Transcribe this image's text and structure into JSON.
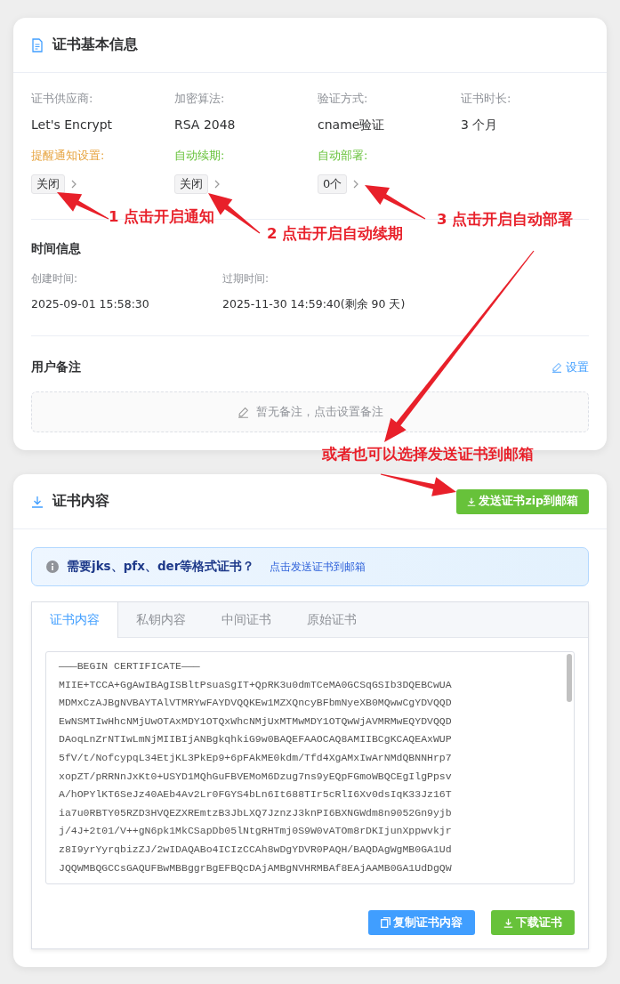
{
  "basic_info": {
    "title": "证书基本信息",
    "fields": [
      {
        "label": "证书供应商:",
        "value": "Let's Encrypt"
      },
      {
        "label": "加密算法:",
        "value": "RSA 2048"
      },
      {
        "label": "验证方式:",
        "value": "cname验证"
      },
      {
        "label": "证书时长:",
        "value": "3 个月"
      }
    ],
    "settings": [
      {
        "label": "提醒通知设置:",
        "value": "关闭",
        "color": "#e6a23c"
      },
      {
        "label": "自动续期:",
        "value": "关闭",
        "color": "#67c23a"
      },
      {
        "label": "自动部署:",
        "value": "0个",
        "color": "#67c23a"
      }
    ],
    "time_info": {
      "title": "时间信息",
      "fields": [
        {
          "label": "创建时间:",
          "value": "2025-09-01 15:58:30"
        },
        {
          "label": "过期时间:",
          "value": "2025-11-30 14:59:40(剩余 90 天)"
        }
      ]
    },
    "remarks": {
      "title": "用户备注",
      "action": "设置",
      "empty_text": "暂无备注，点击设置备注"
    }
  },
  "cert_content": {
    "title": "证书内容",
    "send_button": "发送证书zip到邮箱",
    "notice": {
      "text": "需要jks、pfx、der等格式证书？",
      "link": "点击发送证书到邮箱"
    },
    "tabs": [
      {
        "label": "证书内容",
        "selected": true
      },
      {
        "label": "私钥内容",
        "selected": false
      },
      {
        "label": "中间证书",
        "selected": false
      },
      {
        "label": "原始证书",
        "selected": false
      }
    ],
    "lines": [
      "———BEGIN CERTIFICATE———",
      "MIIE+TCCA+GgAwIBAgISBltPsuaSgIT+QpRK3u0dmTCeMA0GCSqGSIb3DQEBCwUA",
      "MDMxCzAJBgNVBAYTAlVTMRYwFAYDVQQKEw1MZXQncyBFbmNyeXB0MQwwCgYDVQQD",
      "EwNSMTIwHhcNMjUwOTAxMDY1OTQxWhcNMjUxMTMwMDY1OTQwWjAVMRMwEQYDVQQD",
      "DAoqLnZrNTIwLmNjMIIBIjANBgkqhkiG9w0BAQEFAAOCAQ8AMIIBCgKCAQEAxWUP",
      "5fV/t/NofcypqL34EtjKL3PkEp9+6pFAkME0kdm/Tfd4XgAMxIwArNMdQBNNHrp7",
      "xopZT/pRRNnJxKt0+USYD1MQhGuFBVEMoM6Dzug7ns9yEQpFGmoWBQCEgIlgPpsv",
      "A/hOPYlKT6SeJz40AEb4Av2Lr0FGYS4bLn6It688TIr5cRlI6Xv0dsIqK33Jz16T",
      "ia7u0RBTY05RZD3HVQEZXREmtzB3JbLXQ7JznzJ3knPI6BXNGWdm8n9052Gn9yjb",
      "j/4J+2t01/V++gN6pk1MkCSapDb05lNtgRHTmj0S9W0vATOm8rDKIjunXppwvkjr",
      "z8I9yrYyrqbizZJ/2wIDAQABo4ICIzCCAh8wDgYDVR0PAQH/BAQDAgWgMB0GA1Ud",
      "JQQWMBQGCCsGAQUFBwMBBggrBgEFBQcDAjAMBgNVHRMBAf8EAjAAMB0GA1UdDgQW"
    ],
    "buttons": [
      {
        "label": "复制证书内容",
        "kind": "copy"
      },
      {
        "label": "下载证书",
        "kind": "download"
      }
    ]
  },
  "annotations": [
    {
      "text": "1 点击开启通知"
    },
    {
      "text": "2 点击开启自动续期"
    },
    {
      "text": "3 点击开启自动部署"
    },
    {
      "text": "或者也可以选择发送证书到邮箱"
    }
  ]
}
